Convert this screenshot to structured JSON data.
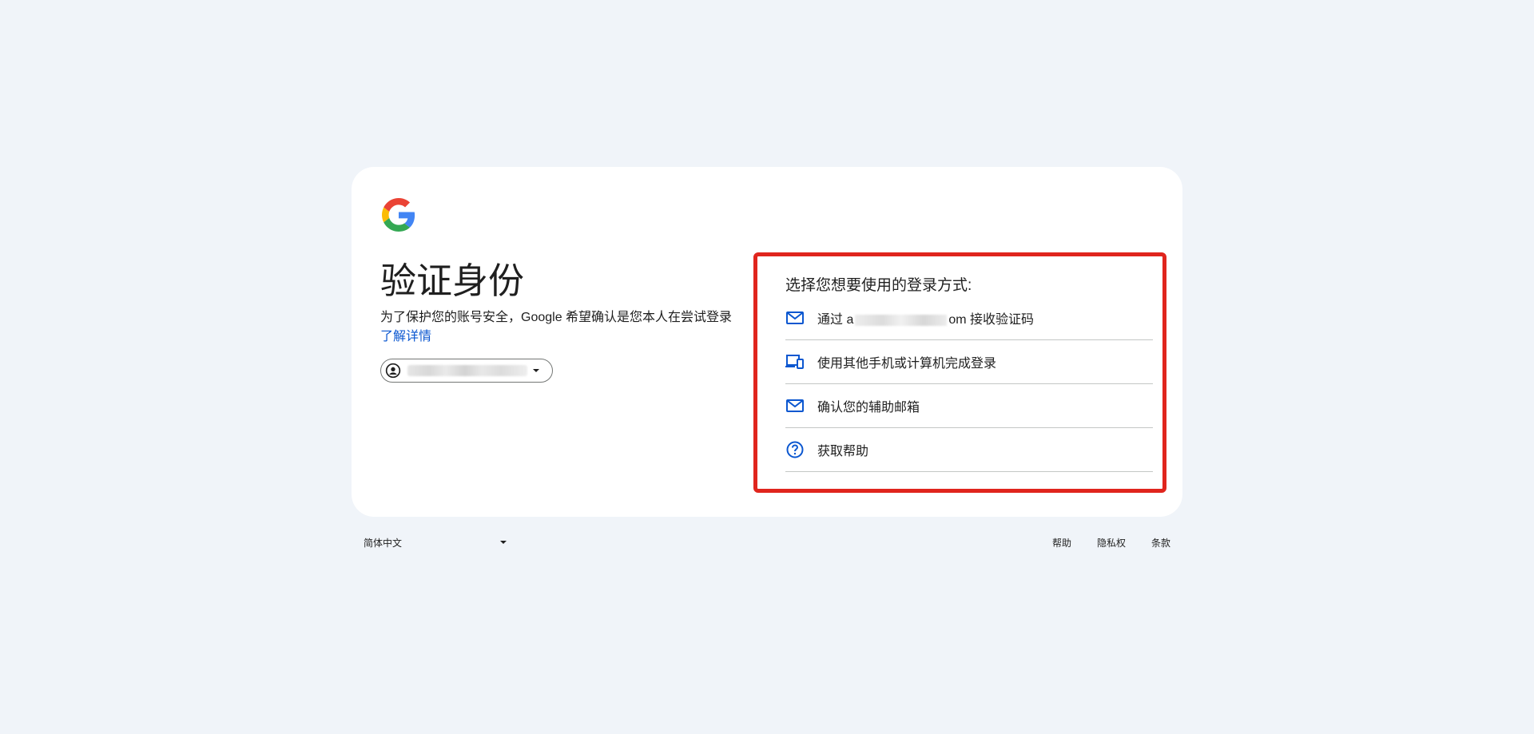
{
  "card": {
    "title": "验证身份",
    "description": "为了保护您的账号安全，Google 希望确认是您本人在尝试登录",
    "learn_more": "了解详情"
  },
  "options": {
    "heading": "选择您想要使用的登录方式:",
    "items": [
      {
        "icon": "mail-icon",
        "prefix": "通过 a",
        "suffix": "om 接收验证码"
      },
      {
        "icon": "devices-icon",
        "label": "使用其他手机或计算机完成登录"
      },
      {
        "icon": "mail-icon",
        "label": "确认您的辅助邮箱"
      },
      {
        "icon": "help-icon",
        "label": "获取帮助"
      }
    ]
  },
  "footer": {
    "language": "简体中文",
    "links": [
      "帮助",
      "隐私权",
      "条款"
    ]
  },
  "colors": {
    "background": "#f0f4f9",
    "card": "#ffffff",
    "accent": "#0b57d0",
    "highlight_border": "#e0251d"
  }
}
